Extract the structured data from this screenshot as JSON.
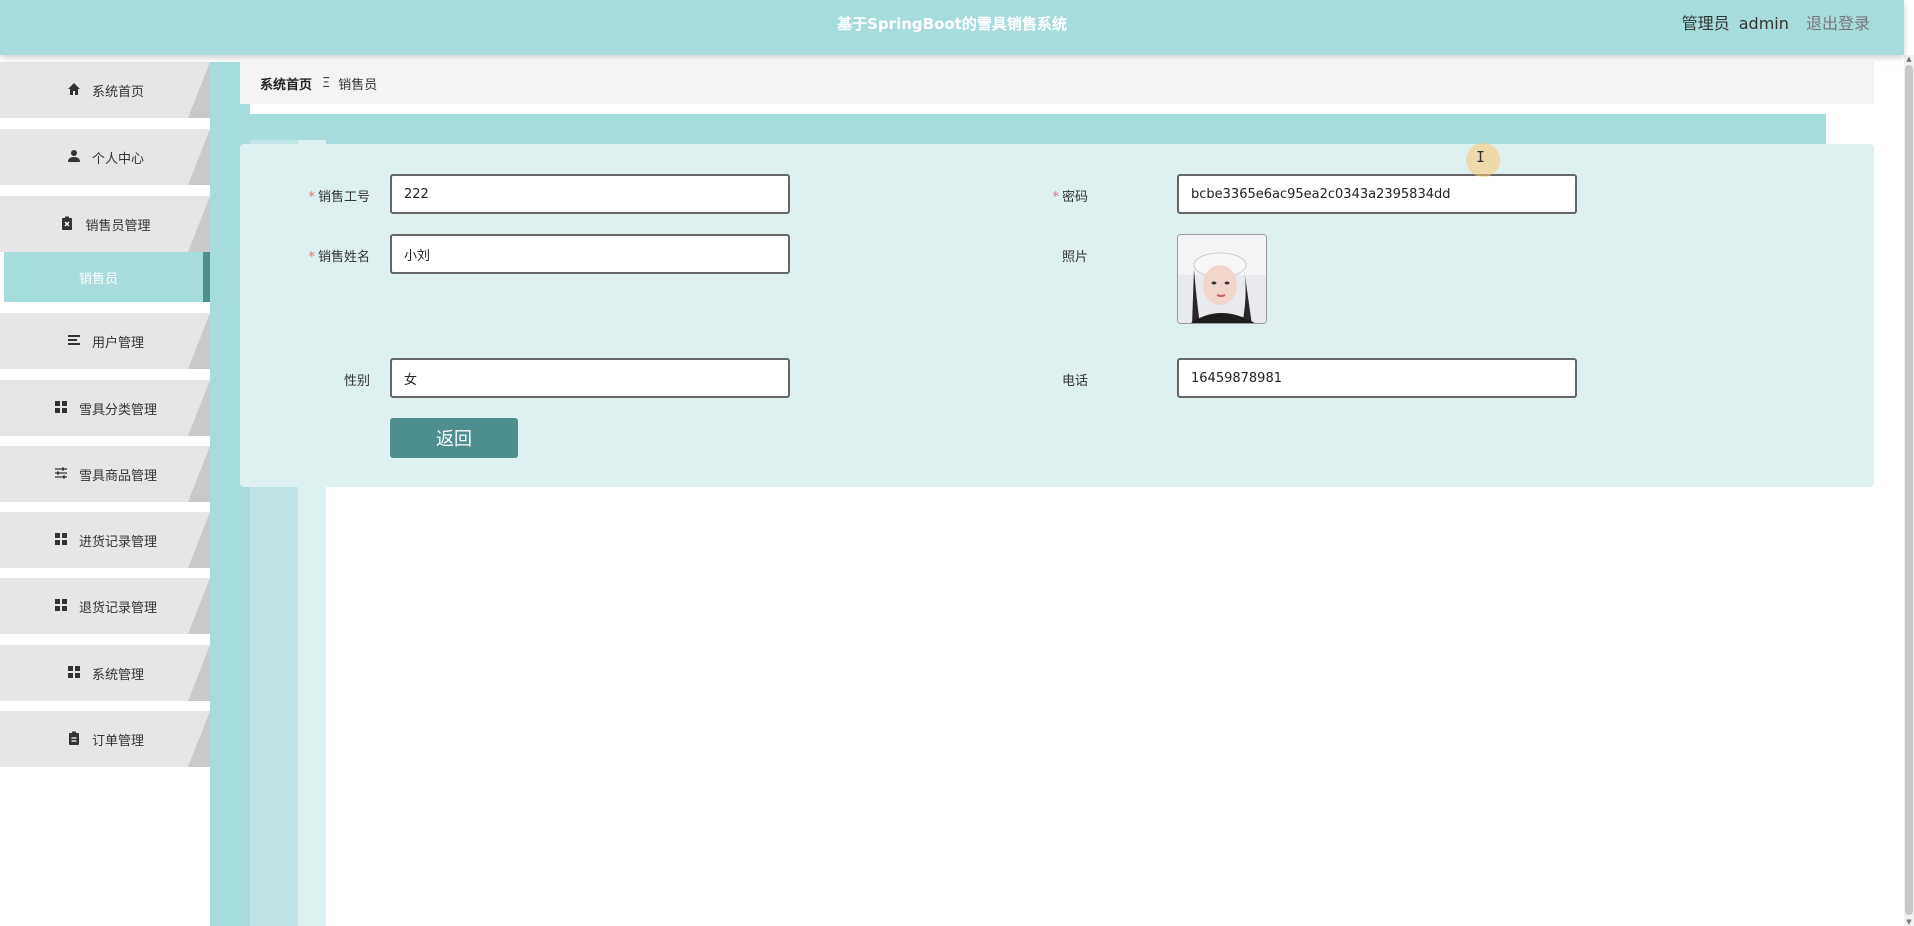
{
  "header": {
    "title": "基于SpringBoot的雪具销售系统",
    "role": "管理员",
    "username": "admin",
    "logout_label": "退出登录"
  },
  "sidebar": {
    "items": [
      {
        "label": "系统首页",
        "icon": "home-icon"
      },
      {
        "label": "个人中心",
        "icon": "user-icon"
      },
      {
        "label": "销售员管理",
        "icon": "clipboard-x-icon"
      },
      {
        "label": "销售员",
        "icon": "",
        "active": true
      },
      {
        "label": "用户管理",
        "icon": "list-icon"
      },
      {
        "label": "雪具分类管理",
        "icon": "grid-icon"
      },
      {
        "label": "雪具商品管理",
        "icon": "sliders-icon"
      },
      {
        "label": "进货记录管理",
        "icon": "grid-icon"
      },
      {
        "label": "退货记录管理",
        "icon": "grid-icon"
      },
      {
        "label": "系统管理",
        "icon": "grid-icon"
      },
      {
        "label": "订单管理",
        "icon": "clipboard-icon"
      }
    ]
  },
  "breadcrumb": {
    "home": "系统首页",
    "separator": "Ξ",
    "current": "销售员"
  },
  "form": {
    "sales_id": {
      "label": "销售工号",
      "required": true,
      "value": "222"
    },
    "password": {
      "label": "密码",
      "required": true,
      "value": "bcbe3365e6ac95ea2c0343a2395834dd"
    },
    "sales_name": {
      "label": "销售姓名",
      "required": true,
      "value": "小刘"
    },
    "photo": {
      "label": "照片"
    },
    "gender": {
      "label": "性别",
      "required": false,
      "value": "女"
    },
    "phone": {
      "label": "电话",
      "required": false,
      "value": "16459878981"
    },
    "back_label": "返回"
  },
  "colors": {
    "accent": "#a7dcdd",
    "button": "#4d8e8e",
    "panel": "#dff0f0",
    "required": "#f56c6c"
  }
}
